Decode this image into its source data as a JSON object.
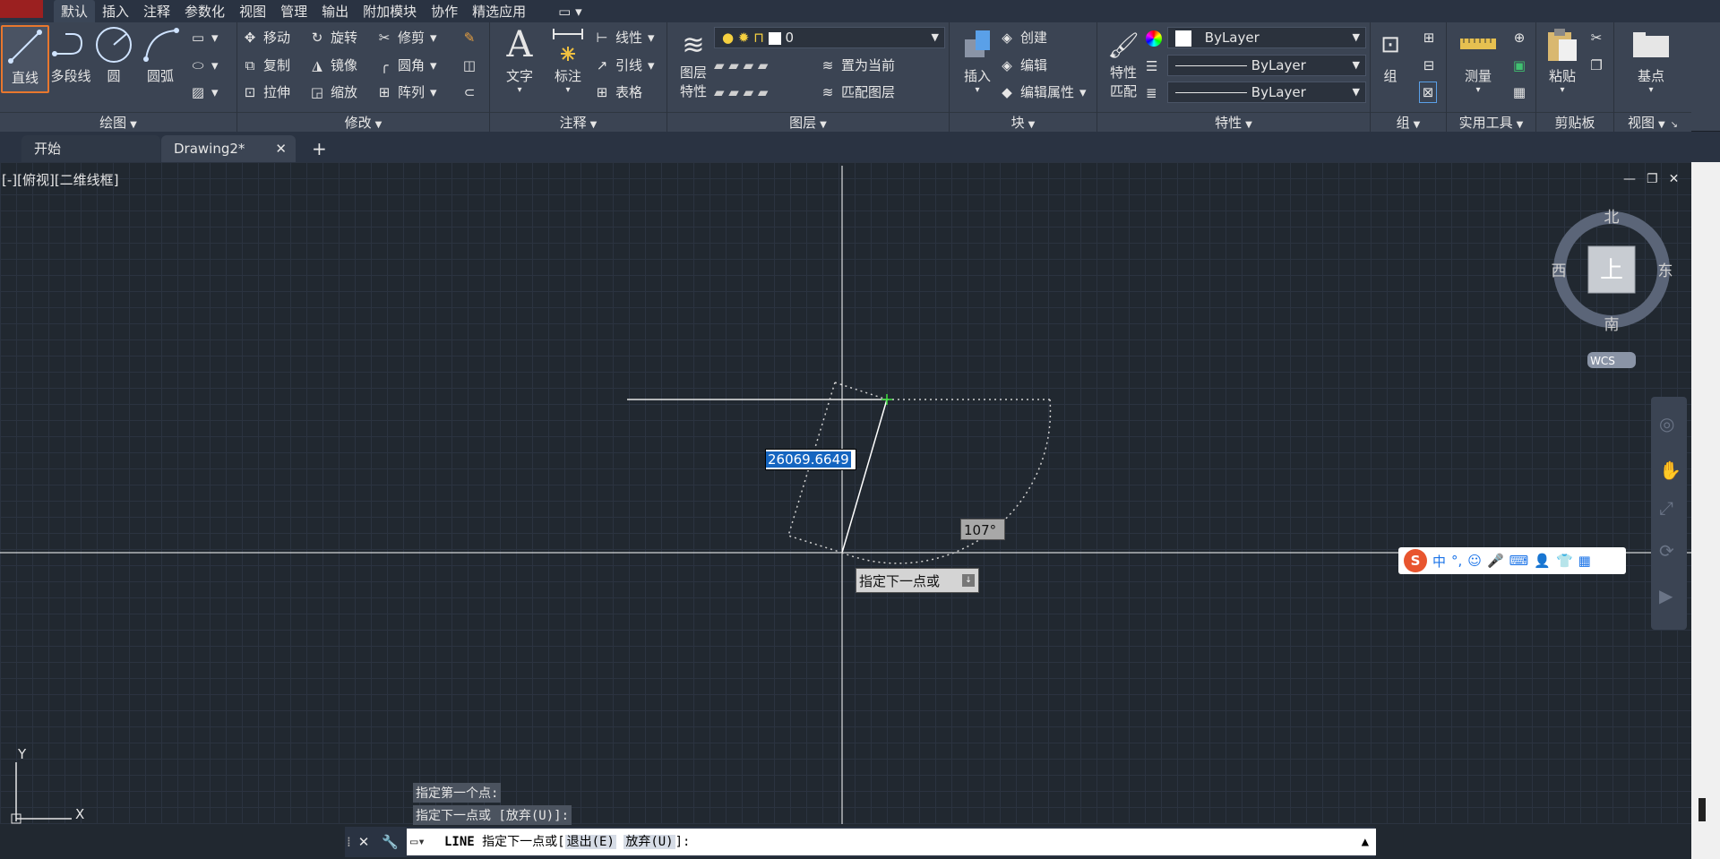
{
  "ribbon_tabs": [
    "默认",
    "插入",
    "注释",
    "参数化",
    "视图",
    "管理",
    "输出",
    "附加模块",
    "协作",
    "精选应用"
  ],
  "ribbon_tab_active": "默认",
  "panels": {
    "draw": {
      "title": "绘图",
      "line": "直线",
      "polyline": "多段线",
      "circle": "圆",
      "arc": "圆弧"
    },
    "modify": {
      "title": "修改",
      "move": "移动",
      "rotate": "旋转",
      "trim": "修剪",
      "copy": "复制",
      "mirror": "镜像",
      "fillet": "圆角",
      "stretch": "拉伸",
      "scale": "缩放",
      "array": "阵列"
    },
    "annotation": {
      "title": "注释",
      "text": "文字",
      "dimension": "标注",
      "linear": "线性",
      "leader": "引线",
      "table": "表格"
    },
    "layers": {
      "title": "图层",
      "layer_props_1": "图层",
      "layer_props_2": "特性",
      "current_layer": "0",
      "set_current": "置为当前",
      "match_layer": "匹配图层"
    },
    "block": {
      "title": "块",
      "insert": "插入",
      "create": "创建",
      "edit": "编辑",
      "edit_attr": "编辑属性"
    },
    "properties": {
      "title": "特性",
      "match_1": "特性",
      "match_2": "匹配",
      "color": "ByLayer",
      "linetype": "ByLayer",
      "lineweight": "ByLayer"
    },
    "groups": {
      "title": "组",
      "group": "组"
    },
    "utilities": {
      "title": "实用工具",
      "measure": "测量"
    },
    "clipboard": {
      "title": "剪贴板",
      "paste": "粘贴"
    },
    "view": {
      "title": "视图",
      "base": "基点"
    }
  },
  "file_tabs": {
    "start": "开始",
    "drawing": "Drawing2*"
  },
  "viewport": {
    "label": "[-][俯视][二维线框]",
    "viewcube": {
      "north": "北",
      "south": "南",
      "east": "东",
      "west": "西",
      "face": "上",
      "wcs": "WCS"
    },
    "ucs": {
      "x": "X",
      "y": "Y"
    },
    "dynamic_input": "26069.6649",
    "angle": "107°",
    "prompt": "指定下一点或"
  },
  "command_history": [
    "指定第一个点:",
    "指定下一点或 [放弃(U)]:"
  ],
  "command_line": {
    "command": "LINE",
    "text": "指定下一点或[",
    "opt1": "退出(E)",
    "opt2": "放弃(U)",
    "end": "]:"
  },
  "ime": {
    "mode": "中",
    "punct": "°,"
  },
  "colors": {
    "accent": "#e8772e",
    "canvas": "#212830",
    "ribbon": "#3b4453",
    "highlight": "#1565c0"
  }
}
